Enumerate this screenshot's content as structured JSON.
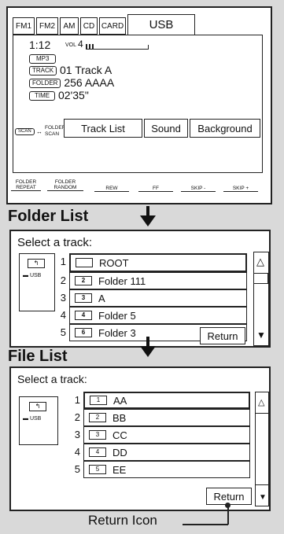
{
  "tabs": [
    "FM1",
    "FM2",
    "AM",
    "CD",
    "CARD",
    "USB"
  ],
  "display": {
    "track_time": "1:12",
    "vol_label": "VOL",
    "vol_value": "4",
    "mp3": "MP3",
    "rows": [
      {
        "label": "TRACK",
        "value": "01  Track A"
      },
      {
        "label": "FOLDER",
        "value": "256 AAAA"
      },
      {
        "label": "TIME",
        "value": "02'35\""
      }
    ]
  },
  "buttons": {
    "scan": "SCAN",
    "folder_scan": "FOLDER\nSCAN",
    "track_list": "Track List",
    "sound": "Sound",
    "background": "Background"
  },
  "bottom_labels": [
    "FOLDER\nREPEAT",
    "FOLDER\nRANDOM",
    "REW",
    "FF",
    "SKIP -",
    "SKIP +"
  ],
  "folder_list": {
    "heading": "Folder List",
    "prompt": "Select a track:",
    "usb": "USB",
    "items": [
      {
        "num": "1",
        "icon": "",
        "name": "ROOT"
      },
      {
        "num": "2",
        "icon": "2",
        "name": "Folder 111"
      },
      {
        "num": "3",
        "icon": "3",
        "name": "A"
      },
      {
        "num": "4",
        "icon": "4",
        "name": "Folder 5"
      },
      {
        "num": "5",
        "icon": "6",
        "name": "Folder 3"
      }
    ],
    "return": "Return"
  },
  "file_list": {
    "heading": "File List",
    "prompt": "Select a track:",
    "usb": "USB",
    "items": [
      {
        "num": "1",
        "icon": "1",
        "name": "AA"
      },
      {
        "num": "2",
        "icon": "2",
        "name": "BB"
      },
      {
        "num": "3",
        "icon": "3",
        "name": "CC"
      },
      {
        "num": "4",
        "icon": "4",
        "name": "DD"
      },
      {
        "num": "5",
        "icon": "5",
        "name": "EE"
      }
    ],
    "return": "Return"
  },
  "callout": "Return Icon",
  "icons": [
    "up-arrow-icon",
    "down-arrow-icon",
    "folder-icon",
    "usb-icon",
    "back-folder-icon"
  ]
}
